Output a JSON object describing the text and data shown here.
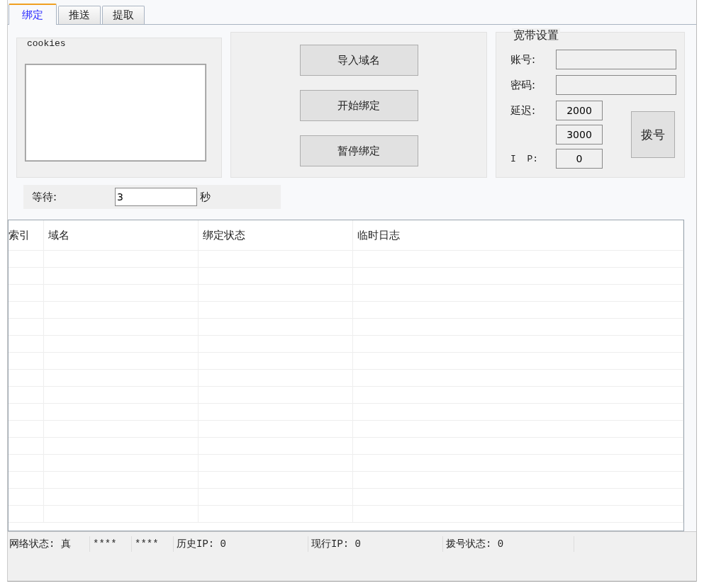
{
  "tabs": [
    {
      "label": "绑定",
      "selected": true
    },
    {
      "label": "推送",
      "selected": false
    },
    {
      "label": "提取",
      "selected": false
    }
  ],
  "cookies": {
    "title": "cookies"
  },
  "actions": [
    "导入域名",
    "开始绑定",
    "暂停绑定"
  ],
  "broadband": {
    "title": "宽带设置",
    "account_label": "账号:",
    "password_label": "密码:",
    "delay_label": "延迟:",
    "delay_values": [
      "2000",
      "3000"
    ],
    "ip_label": "I  P:",
    "ip_value": "0",
    "dial_button": "拨号"
  },
  "wait": {
    "label": "等待:",
    "value": "3",
    "unit": "秒"
  },
  "table": {
    "columns": [
      "索引",
      "域名",
      "绑定状态",
      "临时日志"
    ]
  },
  "status_bar": [
    "网络状态: 真",
    "****",
    "****",
    "历史IP: 0",
    "现行IP: 0",
    "拨号状态: 0"
  ]
}
